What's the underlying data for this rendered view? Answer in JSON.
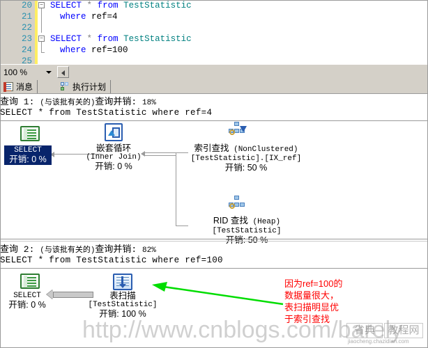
{
  "editor": {
    "lines": [
      {
        "number": "20",
        "fold": "minus",
        "segments": [
          {
            "t": "SELECT",
            "c": "kw"
          },
          {
            "t": " ",
            "c": "plain"
          },
          {
            "t": "*",
            "c": "op"
          },
          {
            "t": " ",
            "c": "plain"
          },
          {
            "t": "from",
            "c": "kw"
          },
          {
            "t": " ",
            "c": "plain"
          },
          {
            "t": "TestStatistic",
            "c": "ident"
          }
        ],
        "text": "SELECT * from TestStatistic"
      },
      {
        "number": "21",
        "fold": "bar",
        "segments": [
          {
            "t": "where",
            "c": "kw"
          },
          {
            "t": " ",
            "c": "plain"
          },
          {
            "t": "ref=4",
            "c": "plain"
          }
        ],
        "text": "where ref=4"
      },
      {
        "number": "22",
        "fold": "bar",
        "segments": [],
        "text": ""
      },
      {
        "number": "23",
        "fold": "minus",
        "segments": [
          {
            "t": "SELECT",
            "c": "kw"
          },
          {
            "t": " ",
            "c": "plain"
          },
          {
            "t": "*",
            "c": "op"
          },
          {
            "t": " ",
            "c": "plain"
          },
          {
            "t": "from",
            "c": "kw"
          },
          {
            "t": " ",
            "c": "plain"
          },
          {
            "t": "TestStatistic",
            "c": "ident"
          }
        ],
        "text": "SELECT * from TestStatistic"
      },
      {
        "number": "24",
        "fold": "end",
        "segments": [
          {
            "t": "where",
            "c": "kw"
          },
          {
            "t": " ",
            "c": "plain"
          },
          {
            "t": "ref=100",
            "c": "plain"
          }
        ],
        "text": "where ref=100"
      },
      {
        "number": "25",
        "fold": "none",
        "segments": [],
        "text": ""
      }
    ]
  },
  "zoombar": {
    "zoom_value": "100 %",
    "scroll_left_icon": "triangle-left-icon"
  },
  "tabs": [
    {
      "id": "messages",
      "label": "消息",
      "icon": "messages-icon",
      "active": false
    },
    {
      "id": "execution-plan",
      "label": "执行计划",
      "icon": "execution-plan-icon",
      "active": true
    }
  ],
  "plans": [
    {
      "id": "query-1",
      "header_prefix": "查询 1: ",
      "header_paren": "(与该批有关的)",
      "header_cost_label": "查询并销: ",
      "header_cost_value": "18%",
      "sql": "SELECT * from TestStatistic where ref=4",
      "nodes": [
        {
          "id": "select-1",
          "icon": "select-result-icon",
          "title": "SELECT",
          "subtitle": "",
          "cost": "开销: 0 %",
          "selected": true
        },
        {
          "id": "nested-loops-1",
          "icon": "nested-loops-icon",
          "title": "嵌套循环",
          "subtitle": "(Inner Join)",
          "cost": "开销: 0 %",
          "selected": false
        },
        {
          "id": "index-seek-1",
          "icon": "index-seek-icon",
          "title": "索引查找",
          "title_suffix": "(NonClustered)",
          "subtitle": "[TestStatistic].[IX_ref]",
          "cost": "开销: 50 %",
          "selected": false
        },
        {
          "id": "rid-lookup-1",
          "icon": "rid-lookup-icon",
          "title": "RID 查找",
          "title_suffix": "(Heap)",
          "subtitle": "[TestStatistic]",
          "cost": "开销: 50 %",
          "selected": false
        }
      ]
    },
    {
      "id": "query-2",
      "header_prefix": "查询 2: ",
      "header_paren": "(与该批有关的)",
      "header_cost_label": "查询并销: ",
      "header_cost_value": "82%",
      "sql": "SELECT * from TestStatistic where ref=100",
      "nodes": [
        {
          "id": "select-2",
          "icon": "select-result-icon",
          "title": "SELECT",
          "subtitle": "",
          "cost": "开销: 0 %",
          "selected": false
        },
        {
          "id": "table-scan-2",
          "icon": "table-scan-icon",
          "title": "表扫描",
          "subtitle": "[TestStatistic]",
          "cost": "开销: 100 %",
          "selected": false
        }
      ]
    }
  ],
  "annotation": {
    "color": "#ff0000",
    "line1": "因为ref=100的",
    "line2": "数据量很大，",
    "line3": "表扫描明显优",
    "line4": "于索引查找",
    "arrow_icon": "green-arrow-pointer",
    "arrow_color": "#00dd00"
  },
  "watermark": {
    "url": "http://www.cnblogs.com/barely",
    "logo_left": "省典",
    "logo_right": "教程网",
    "logo_sub": "jiaocheng.chazidian.com"
  }
}
